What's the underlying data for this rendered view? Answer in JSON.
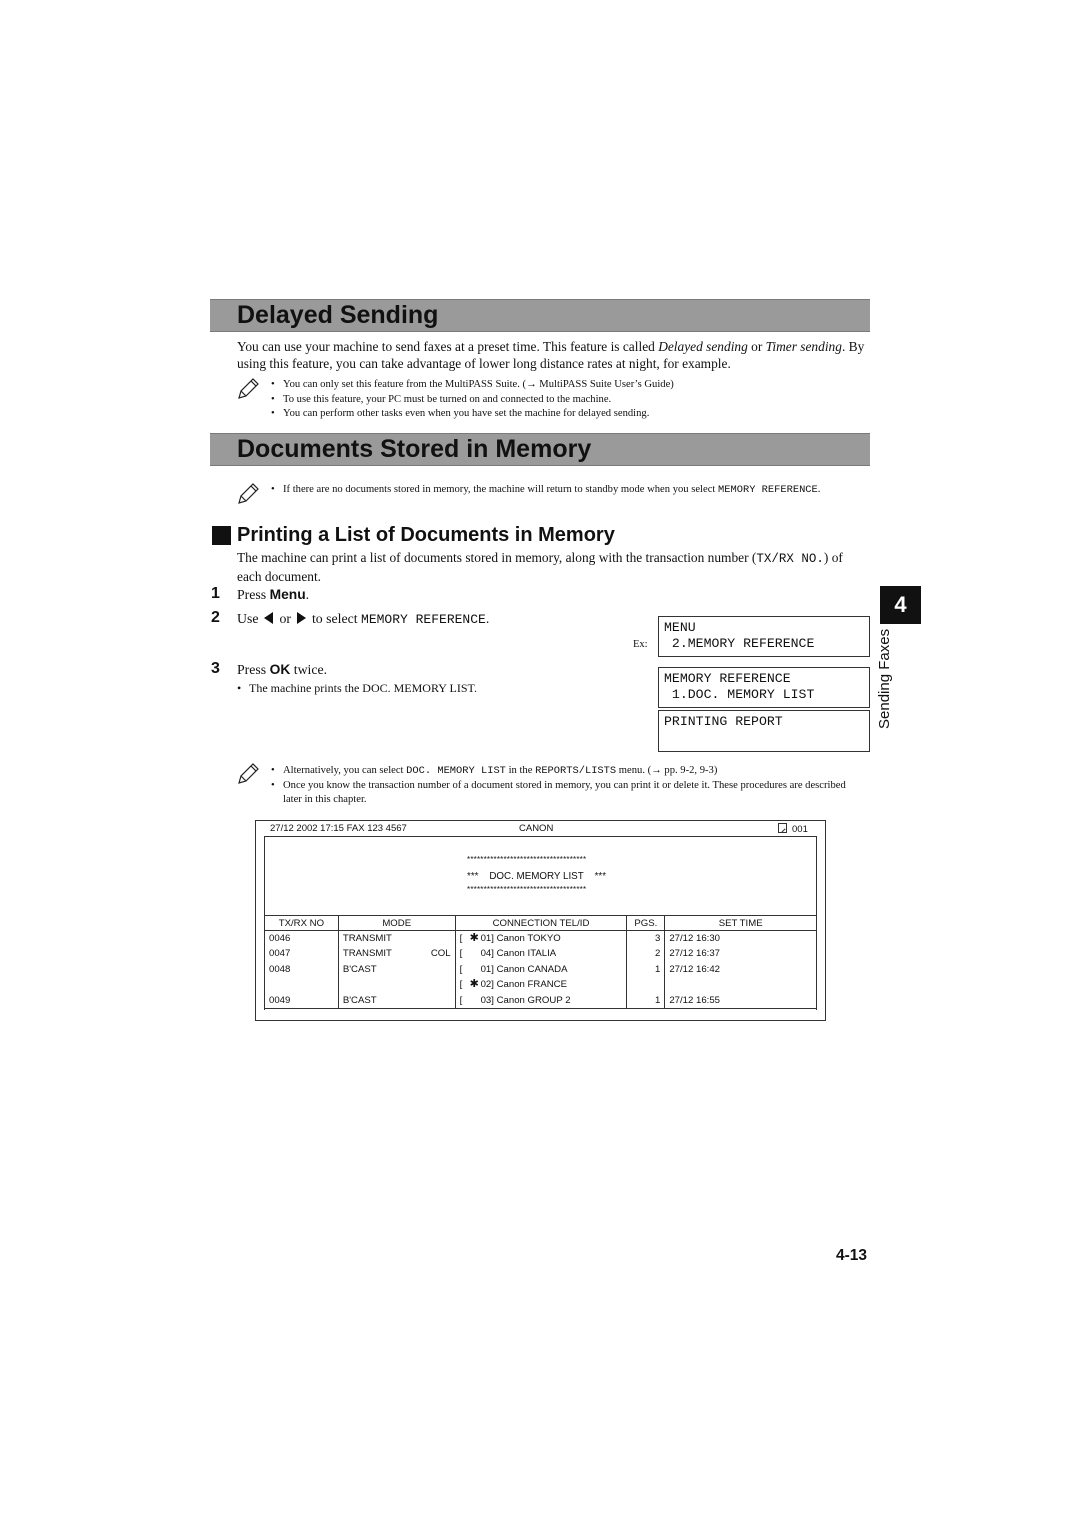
{
  "section1": {
    "title": "Delayed Sending",
    "body_parts": [
      {
        "text": "You can use your machine to send faxes at a preset time. This feature is called ",
        "style": "normal"
      },
      {
        "text": "Delayed sending",
        "style": "italic"
      },
      {
        "text": " or ",
        "style": "normal"
      },
      {
        "text": "Timer sending",
        "style": "italic"
      },
      {
        "text": ". By using this feature, you can take advantage of lower long distance rates at night, for example.",
        "style": "normal"
      }
    ],
    "notes": [
      "You can only set this feature from the MultiPASS Suite. (→ MultiPASS Suite User’s Guide)",
      "To use this feature, your PC must be turned on and connected to the machine.",
      "You can perform other tasks even when you have set the machine for delayed sending."
    ]
  },
  "section2": {
    "title": "Documents Stored in Memory",
    "note": {
      "prefix": "If there are no documents stored in memory, the machine will return to standby mode when you select ",
      "code": "MEMORY REFERENCE",
      "suffix": "."
    }
  },
  "subsection": {
    "title": "Printing a List of Documents in Memory",
    "intro_prefix": "The machine can print a list of documents stored in memory, along with the transaction number (",
    "intro_code": "TX/RX NO.",
    "intro_suffix": ") of each document."
  },
  "steps": [
    {
      "num": "1",
      "prefix": "Press ",
      "key": "Menu",
      "suffix": "."
    },
    {
      "num": "2",
      "prefix": "Use",
      "mid": "or",
      "after_arrows": "to select ",
      "code": "MEMORY REFERENCE",
      "suffix": "."
    },
    {
      "num": "3",
      "prefix": "Press ",
      "key": "OK",
      "suffix": " twice.",
      "sub": "The machine prints the DOC. MEMORY LIST."
    }
  ],
  "lcd": {
    "ex_label": "Ex:",
    "screens": [
      {
        "line1": "MENU",
        "line2": " 2.MEMORY REFERENCE"
      },
      {
        "line1": "MEMORY REFERENCE",
        "line2": " 1.DOC. MEMORY LIST"
      },
      {
        "line1": "PRINTING REPORT",
        "line2": ""
      }
    ]
  },
  "chapter": {
    "number": "4",
    "label": "Sending Faxes"
  },
  "notes2": [
    {
      "prefix": "Alternatively, you can select ",
      "code1": "DOC. MEMORY LIST",
      "mid": " in the ",
      "code2": "REPORTS/LISTS",
      "suffix": " menu. (→ pp. 9-2, 9-3)"
    },
    {
      "text": "Once you know the transaction number of a document stored in memory, you can print it or delete it. These procedures are described later in this chapter."
    }
  ],
  "report": {
    "header_left": "27/12 2002 17:15 FAX 123 4567",
    "header_center": "CANON",
    "header_page": "001",
    "stars": "************************************",
    "list_title_prefix": "***",
    "list_title": "DOC. MEMORY LIST",
    "list_title_suffix": "***",
    "columns": [
      "TX/RX NO",
      "MODE",
      "CONNECTION TEL/ID",
      "PGS.",
      "SET TIME"
    ],
    "rows": [
      {
        "txrx": "0046",
        "mode": "TRANSMIT",
        "tag": "",
        "star": true,
        "conn": "01] Canon TOKYO",
        "pgs": "3",
        "time": "27/12 16:30"
      },
      {
        "txrx": "0047",
        "mode": "TRANSMIT",
        "tag": "COL",
        "star": false,
        "conn": "04] Canon ITALIA",
        "pgs": "2",
        "time": "27/12 16:37"
      },
      {
        "txrx": "0048",
        "mode": "B'CAST",
        "tag": "",
        "star": false,
        "conn": "01] Canon CANADA",
        "pgs": "1",
        "time": "27/12 16:42"
      },
      {
        "txrx": "",
        "mode": "",
        "tag": "",
        "star": true,
        "conn": "02] Canon FRANCE",
        "pgs": "",
        "time": ""
      },
      {
        "txrx": "0049",
        "mode": "B'CAST",
        "tag": "",
        "star": false,
        "conn": "03] Canon GROUP 2",
        "pgs": "1",
        "time": "27/12 16:55"
      }
    ]
  },
  "page_number": "4-13"
}
